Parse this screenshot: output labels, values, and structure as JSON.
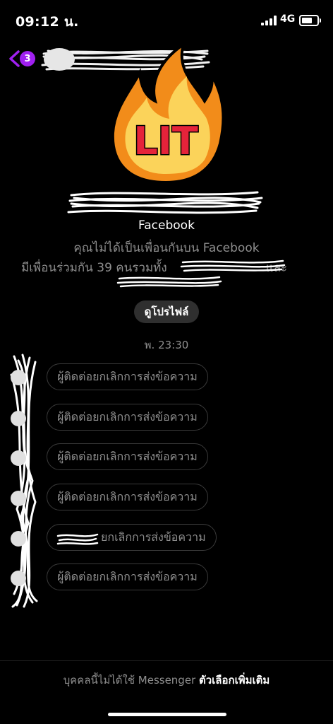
{
  "status": {
    "time": "09:12 น.",
    "network": "4G"
  },
  "nav": {
    "badge": "3"
  },
  "avatar": {
    "sticker_text": "LIT"
  },
  "profile": {
    "source": "Facebook",
    "not_friends": "คุณไม่ได้เป็นเพื่อนกันบน Facebook",
    "mutual_prefix": "มีเพื่อนร่วมกัน 39 คนรวมทั้ง",
    "mutual_suffix": "และ",
    "view_profile_button": "ดูโปรไฟล์"
  },
  "timestamp": "พ. 23:30",
  "messages": [
    "ผู้ติดต่อยกเลิกการส่งข้อความ",
    "ผู้ติดต่อยกเลิกการส่งข้อความ",
    "ผู้ติดต่อยกเลิกการส่งข้อความ",
    "ผู้ติดต่อยกเลิกการส่งข้อความ",
    "ยกเลิกการส่งข้อความ",
    "ผู้ติดต่อยกเลิกการส่งข้อความ"
  ],
  "footer": {
    "note": "บุคคลนี้ไม่ได้ใช้ Messenger",
    "action": "ตัวเลือกเพิ่มเติม"
  },
  "colors": {
    "background": "#000000",
    "badge": "#a020f0",
    "muted_text": "#8e8e8e",
    "bubble_border": "#3a3a3a",
    "flame_outer": "#f28c1a",
    "flame_inner": "#fbd35a",
    "lit_text": "#e5233a"
  },
  "icons": {
    "back": "chevron-left-icon",
    "signal": "signal-bars-icon",
    "battery": "battery-icon"
  }
}
